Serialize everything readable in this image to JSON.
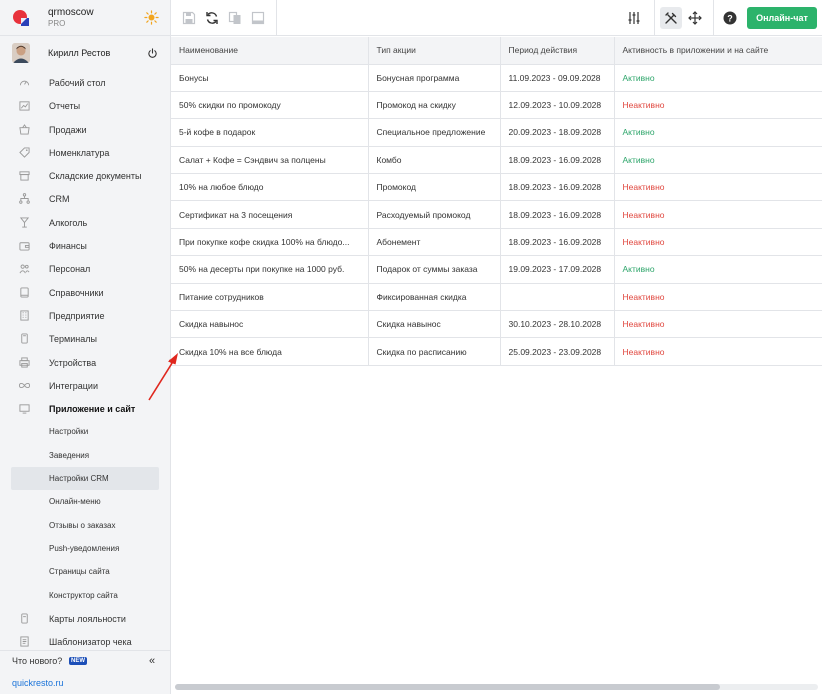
{
  "brand": {
    "name": "qrmoscow",
    "plan": "PRO"
  },
  "user": {
    "name": "Кирилл Рестов"
  },
  "menu": [
    {
      "label": "Рабочий стол",
      "icon": "speedometer-icon"
    },
    {
      "label": "Отчеты",
      "icon": "chart-icon"
    },
    {
      "label": "Продажи",
      "icon": "basket-icon"
    },
    {
      "label": "Номенклатура",
      "icon": "tag-icon"
    },
    {
      "label": "Складские документы",
      "icon": "box-icon"
    },
    {
      "label": "CRM",
      "icon": "hierarchy-icon"
    },
    {
      "label": "Алкоголь",
      "icon": "glass-icon"
    },
    {
      "label": "Финансы",
      "icon": "wallet-icon"
    },
    {
      "label": "Персонал",
      "icon": "people-icon"
    },
    {
      "label": "Справочники",
      "icon": "book-icon"
    },
    {
      "label": "Предприятие",
      "icon": "building-icon"
    },
    {
      "label": "Терминалы",
      "icon": "terminal-icon"
    },
    {
      "label": "Устройства",
      "icon": "printer-icon"
    },
    {
      "label": "Интеграции",
      "icon": "infinity-icon"
    },
    {
      "label": "Приложение и сайт",
      "icon": "monitor-icon"
    }
  ],
  "submenu": [
    "Настройки",
    "Заведения",
    "Настройки CRM",
    "Онлайн-меню",
    "Отзывы о заказах",
    "Push-уведомления",
    "Страницы сайта",
    "Конструктор сайта"
  ],
  "menu_bottom": [
    {
      "label": "Карты лояльности",
      "icon": "card-icon"
    },
    {
      "label": "Шаблонизатор чека",
      "icon": "receipt-icon"
    }
  ],
  "footer": {
    "whats_new": "Что нового?",
    "badge": "NEW",
    "collapse": "«",
    "site": "quickresto.ru"
  },
  "toolbar": {
    "chat_label": "Онлайн-чат"
  },
  "table": {
    "columns": [
      "Наименование",
      "Тип акции",
      "Период действия",
      "Активность в приложении и на сайте"
    ],
    "rows": [
      [
        "Бонусы",
        "Бонусная программа",
        "11.09.2023 - 09.09.2028",
        "Активно"
      ],
      [
        "50% скидки по промокоду",
        "Промокод на скидку",
        "12.09.2023 - 10.09.2028",
        "Неактивно"
      ],
      [
        "5-й кофе в подарок",
        "Специальное предложение",
        "20.09.2023 - 18.09.2028",
        "Активно"
      ],
      [
        "Салат + Кофе = Сэндвич за полцены",
        "Комбо",
        "18.09.2023 - 16.09.2028",
        "Активно"
      ],
      [
        "10% на любое блюдо",
        "Промокод",
        "18.09.2023 - 16.09.2028",
        "Неактивно"
      ],
      [
        "Сертификат на 3 посещения",
        "Расходуемый промокод",
        "18.09.2023 - 16.09.2028",
        "Неактивно"
      ],
      [
        "При покупке кофе скидка 100% на блюдо...",
        "Абонемент",
        "18.09.2023 - 16.09.2028",
        "Неактивно"
      ],
      [
        "50% на десерты при покупке на 1000 руб.",
        "Подарок от суммы заказа",
        "19.09.2023 - 17.09.2028",
        "Активно"
      ],
      [
        "Питание сотрудников",
        "Фиксированная скидка",
        "",
        "Неактивно"
      ],
      [
        "Скидка навынос",
        "Скидка навынос",
        "30.10.2023 - 28.10.2028",
        "Неактивно"
      ],
      [
        "Скидка 10% на все блюда",
        "Скидка по расписанию",
        "25.09.2023 - 23.09.2028",
        "Неактивно"
      ]
    ]
  },
  "colors": {
    "accent": "#2cb36b",
    "active": "#2da56a",
    "inactive": "#e0473f",
    "link": "#1a73d9",
    "annotation": "#e0271e"
  }
}
